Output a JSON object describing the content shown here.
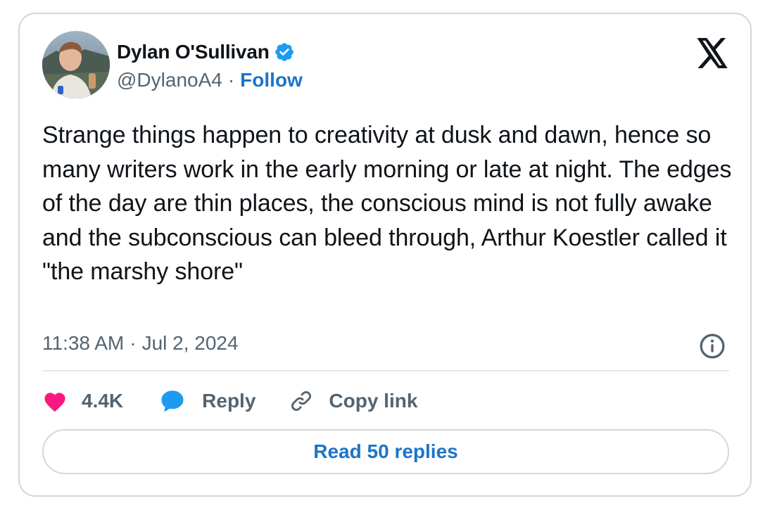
{
  "author": {
    "name": "Dylan O'Sullivan",
    "handle": "@DylanoA4",
    "separator": "·",
    "follow_label": "Follow"
  },
  "tweet": {
    "text": "Strange things happen to creativity at dusk and dawn, hence so many writers work in the early morning or late at night. The edges of the day are thin places, the conscious mind is not fully awake and the subconscious can bleed through, Arthur Koestler called it \"the marshy shore\"",
    "time": "11:38 AM",
    "separator": "·",
    "date": "Jul 2, 2024"
  },
  "actions": {
    "like_count": "4.4K",
    "reply_label": "Reply",
    "copy_label": "Copy link"
  },
  "read_replies_label": "Read 50 replies",
  "icons": {
    "brand": "x-logo-icon",
    "verified": "verified-badge-icon",
    "info": "info-icon",
    "like": "heart-icon",
    "reply": "speech-bubble-icon",
    "copy": "link-icon"
  },
  "colors": {
    "link_blue": "#1d74c9",
    "verified_blue": "#1d9bf0",
    "heart_pink": "#f91880",
    "text_primary": "#0f1419",
    "text_secondary": "#536471",
    "border": "#cfd9de"
  }
}
